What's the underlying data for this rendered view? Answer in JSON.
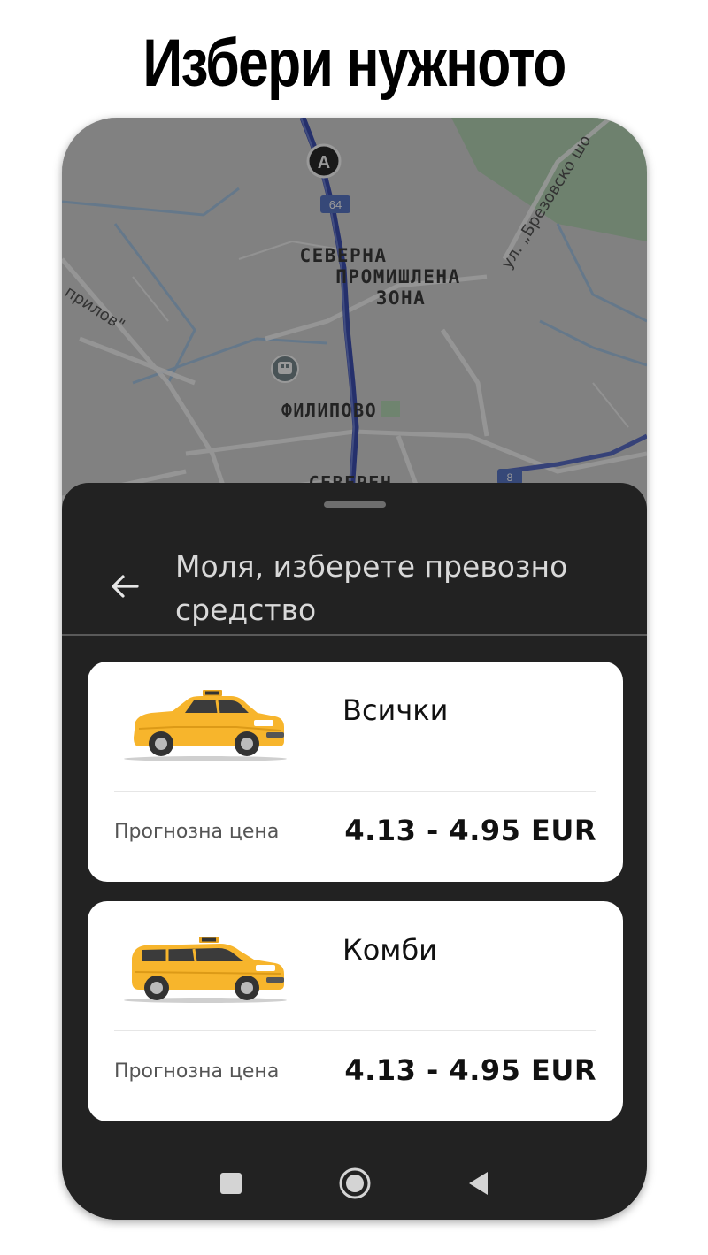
{
  "headline": "Избери нужното",
  "map": {
    "labels": {
      "zone_line1": "СЕВЕРНА",
      "zone_line2": "ПРОМИШЛЕНА",
      "zone_line3": "ЗОНА",
      "filipovo": "ФИЛИПОВО",
      "severen": "СЕВЕРЕН",
      "street_brezovsko": "ул. „Брезовско шо",
      "street_prilov": "прилов\"",
      "road_badge": "64",
      "marker_letter": "A",
      "road_badge_2": "8"
    },
    "route_color": "#3f51b5"
  },
  "sheet": {
    "title": "Моля, изберете превозно средство",
    "back_icon": "arrow-left-icon"
  },
  "vehicles": [
    {
      "name": "Всички",
      "price_label": "Прогнозна цена",
      "price": "4.13 - 4.95 EUR",
      "icon": "taxi-sedan-icon"
    },
    {
      "name": "Комби",
      "price_label": "Прогнозна цена",
      "price": "4.13 - 4.95 EUR",
      "icon": "taxi-wagon-icon"
    }
  ],
  "navigation": {
    "recents_icon": "square-recents-icon",
    "home_icon": "circle-home-icon",
    "back_icon": "triangle-back-icon"
  },
  "colors": {
    "taxi_yellow": "#f7b52c",
    "sheet_background": "#222222",
    "card_background": "#ffffff"
  }
}
